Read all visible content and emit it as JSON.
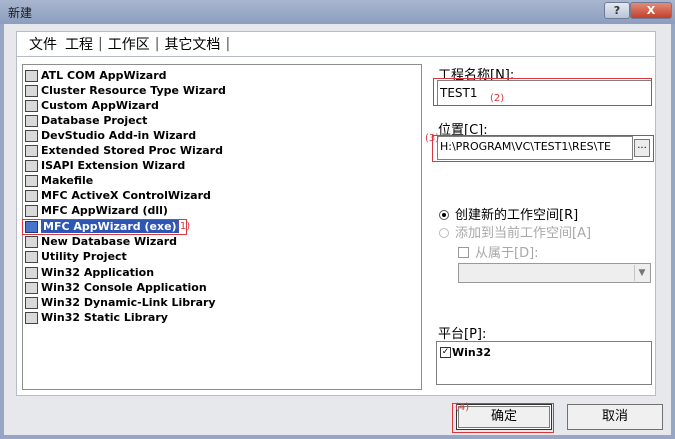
{
  "window": {
    "title": "新建",
    "help_label": "?",
    "close_label": "X"
  },
  "tabs": [
    {
      "label": "文件"
    },
    {
      "label": "工程"
    },
    {
      "label": "工作区"
    },
    {
      "label": "其它文档"
    }
  ],
  "tab_separator": "|",
  "project_types": [
    {
      "label": "ATL COM AppWizard",
      "icon": "atl-com-icon"
    },
    {
      "label": "Cluster Resource Type Wizard",
      "icon": "cluster-icon"
    },
    {
      "label": "Custom AppWizard",
      "icon": "custom-wizard-icon"
    },
    {
      "label": "Database Project",
      "icon": "database-icon"
    },
    {
      "label": "DevStudio Add-in Wizard",
      "icon": "addin-icon"
    },
    {
      "label": "Extended Stored Proc Wizard",
      "icon": "stored-proc-icon"
    },
    {
      "label": "ISAPI Extension Wizard",
      "icon": "isapi-icon"
    },
    {
      "label": "Makefile",
      "icon": "makefile-icon"
    },
    {
      "label": "MFC ActiveX ControlWizard",
      "icon": "activex-icon"
    },
    {
      "label": "MFC AppWizard (dll)",
      "icon": "mfc-dll-icon"
    },
    {
      "label": "MFC AppWizard (exe)",
      "icon": "mfc-exe-icon",
      "selected": true
    },
    {
      "label": "New Database Wizard",
      "icon": "new-db-icon"
    },
    {
      "label": "Utility Project",
      "icon": "utility-icon"
    },
    {
      "label": "Win32 Application",
      "icon": "win32-app-icon"
    },
    {
      "label": "Win32 Console Application",
      "icon": "console-icon"
    },
    {
      "label": "Win32 Dynamic-Link Library",
      "icon": "dll-icon"
    },
    {
      "label": "Win32 Static Library",
      "icon": "static-lib-icon"
    }
  ],
  "project_name": {
    "label": "工程名称[N]:",
    "value": "TEST1"
  },
  "location": {
    "label": "位置[C]:",
    "value": "H:\\PROGRAM\\VC\\TEST1\\RES\\TE",
    "browse_label": "..."
  },
  "workspace": {
    "create_new_label": "创建新的工作空间[R]",
    "add_to_current_label": "添加到当前工作空间[A]",
    "dependency_label": "从属于[D]:",
    "dependency_value": ""
  },
  "platform": {
    "label": "平台[P]:",
    "items": [
      {
        "label": "Win32",
        "checked": true
      }
    ]
  },
  "buttons": {
    "ok_label": "确定",
    "cancel_label": "取消"
  },
  "annotations": {
    "n1": "(1)",
    "n2": "(2)",
    "n3": "(3)",
    "n4": "(4)",
    "color": "#d9363e"
  },
  "colors": {
    "selection": "#2e56b5",
    "title_bar": "#97a6c4"
  }
}
